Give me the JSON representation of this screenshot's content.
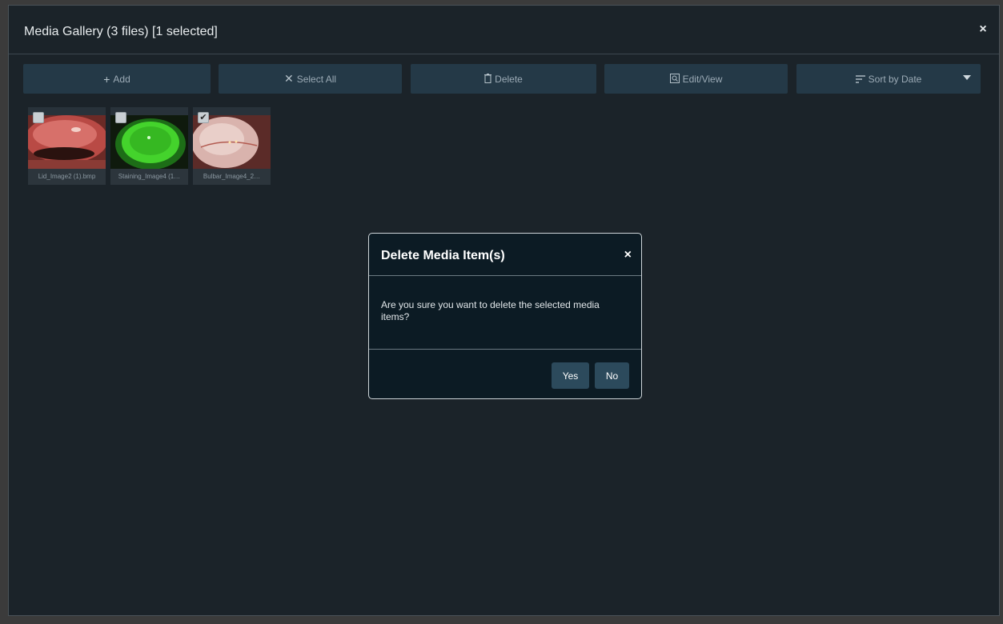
{
  "window": {
    "title": "Media Gallery (3 files) [1 selected]",
    "close_glyph": "×"
  },
  "toolbar": {
    "add": {
      "icon": "+",
      "label": "Add"
    },
    "select_all": {
      "icon": "✕",
      "label": "Select All"
    },
    "delete": {
      "icon": "🗑",
      "label": "Delete"
    },
    "edit_view": {
      "icon": "⧉",
      "label": "Edit/View"
    },
    "sort": {
      "icon": "≡",
      "label": "Sort by Date"
    }
  },
  "thumbnails": [
    {
      "caption": "Lid_Image2 (1).bmp",
      "checked": false,
      "check_glyph": ""
    },
    {
      "caption": "Staining_Image4 (1…",
      "checked": false,
      "check_glyph": ""
    },
    {
      "caption": "Bulbar_Image4_2…",
      "checked": true,
      "check_glyph": "✔"
    }
  ],
  "dialog": {
    "title": "Delete Media Item(s)",
    "close_glyph": "×",
    "message": "Are you sure you want to delete the selected media items?",
    "yes_label": "Yes",
    "no_label": "No"
  },
  "colors": {
    "window_bg": "#1b2329",
    "toolbar_button": "#243947",
    "dialog_bg": "#0c1b24",
    "dialog_button": "#2c4a5c"
  }
}
